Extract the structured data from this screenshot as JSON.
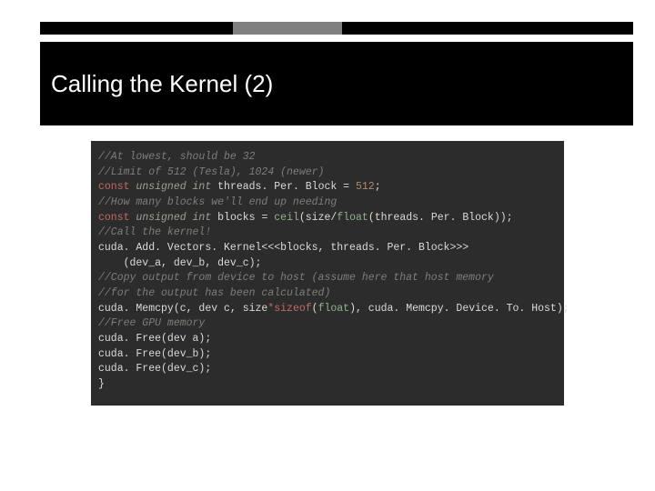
{
  "slide": {
    "title": "Calling the Kernel (2)"
  },
  "code": {
    "l1": "//At lowest, should be 32",
    "l2": "//Limit of 512 (Tesla), 1024 (newer)",
    "l3a": "const",
    "l3b": "unsigned int",
    "l3c": " threads. Per. Block = ",
    "l3d": "512",
    "l3e": ";",
    "l4": "",
    "l5": "//How many blocks we'll end up needing",
    "l6a": "const",
    "l6b": "unsigned int",
    "l6c": " blocks = ",
    "l6d": "ceil",
    "l6e": "(size/",
    "l6f": "float",
    "l6g": "(threads. Per. Block));",
    "l7": "",
    "l8": "//Call the kernel!",
    "l9": "cuda. Add. Vectors. Kernel<<<blocks, threads. Per. Block>>>",
    "l10": "    (dev_a, dev_b, dev_c);",
    "l11": "",
    "l12": "//Copy output from device to host (assume here that host memory",
    "l13": "//for the output has been calculated)",
    "l14": "",
    "l15a": "cuda. Memcpy(c, dev c, size",
    "l15b": "*",
    "l15c": "sizeof",
    "l15d": "(",
    "l15e": "float",
    "l15f": "), cuda. Memcpy. Device. To. Host);",
    "l16": "",
    "l17": "//Free GPU memory",
    "l18": "cuda. Free(dev a);",
    "l19": "cuda. Free(dev_b);",
    "l20": "cuda. Free(dev_c);",
    "l21": "}"
  }
}
